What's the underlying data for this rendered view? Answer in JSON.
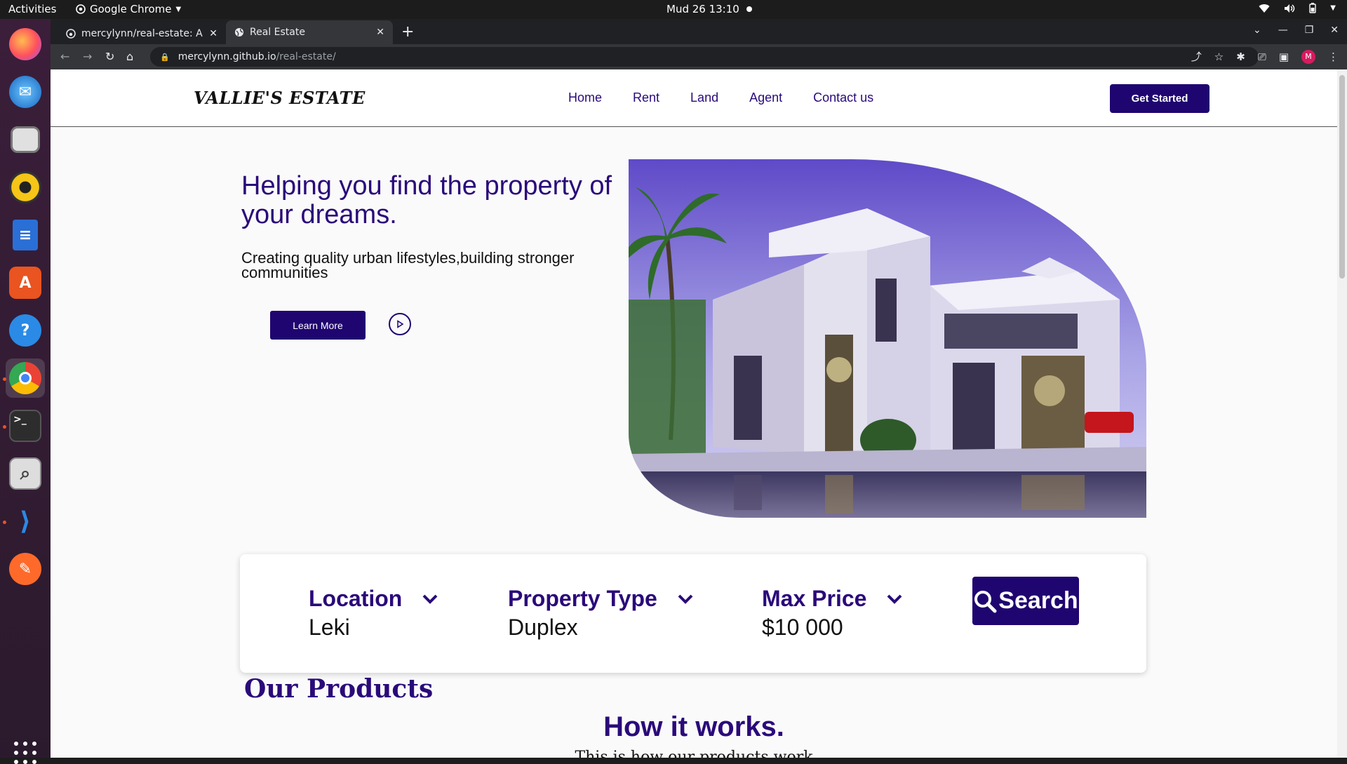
{
  "system": {
    "activities": "Activities",
    "app_name": "Google Chrome",
    "clock": "Mud 26  13:10"
  },
  "browser": {
    "tabs": [
      {
        "label": "mercylynn/real-estate: A r",
        "active": false
      },
      {
        "label": "Real Estate",
        "active": true
      }
    ],
    "url_host": "mercylynn.github.io",
    "url_path": "/real-estate/",
    "profile_initial": "M"
  },
  "site": {
    "brand": "VALLIE'S ESTATE",
    "nav": [
      "Home",
      "Rent",
      "Land",
      "Agent",
      "Contact us"
    ],
    "cta": "Get Started",
    "hero": {
      "title": "Helping you find the property of your dreams.",
      "subtitle": "Creating quality urban lifestyles,building stronger communities",
      "learn_more": "Learn More"
    },
    "filters": [
      {
        "label": "Location",
        "value": "Leki"
      },
      {
        "label": "Property Type",
        "value": "Duplex"
      },
      {
        "label": "Max Price",
        "value": "$10 000"
      }
    ],
    "search_label": "Search",
    "products_title": "Our Products",
    "how_title": "How it works.",
    "how_subtitle": "This is how our products work"
  },
  "colors": {
    "brand_primary": "#1f0570",
    "brand_text": "#2a0a7a"
  }
}
